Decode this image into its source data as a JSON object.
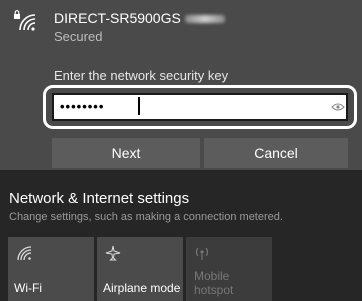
{
  "network": {
    "ssid": "DIRECT-SR5900GS",
    "status": "Secured"
  },
  "key_prompt": {
    "label": "Enter the network security key",
    "masked_value": "••••••••"
  },
  "buttons": {
    "next": "Next",
    "cancel": "Cancel"
  },
  "settings": {
    "title": "Network & Internet settings",
    "subtitle": "Change settings, such as making a connection metered."
  },
  "tiles": [
    {
      "label": "Wi-Fi",
      "icon": "wifi-icon"
    },
    {
      "label": "Airplane mode",
      "icon": "airplane-icon"
    },
    {
      "label_line1": "Mobile",
      "label_line2": "hotspot",
      "icon": "hotspot-icon"
    }
  ],
  "colors": {
    "panel": "#4a4a4a",
    "background": "#262626",
    "button": "#5c5c5c"
  }
}
